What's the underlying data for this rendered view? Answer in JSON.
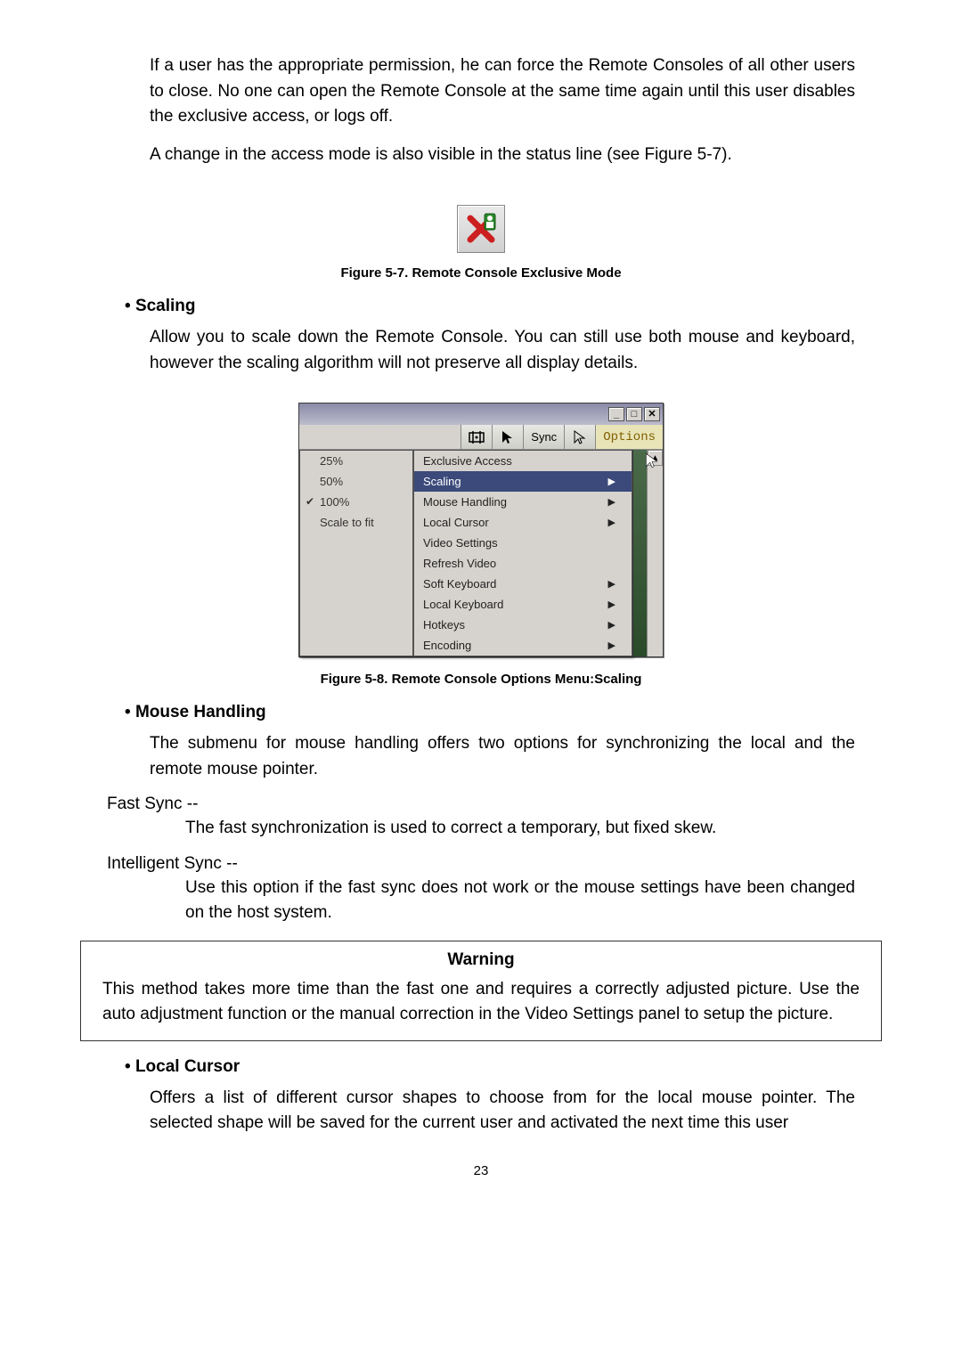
{
  "paragraphs": {
    "p1": "If a user has the appropriate permission, he can force the Remote Consoles of all other users to close. No one can open the Remote Console at the same time again until this user disables the exclusive access, or logs off.",
    "p2": "A change in the access mode is also visible in the status line (see Figure 5-7).",
    "scaling": "Allow you to scale down the Remote Console. You can still use both mouse and keyboard, however the scaling algorithm will not preserve all display details.",
    "mouse_handling": "The submenu for mouse handling offers two options for synchronizing the local and the remote mouse pointer.",
    "fast_sync_label": "Fast Sync --",
    "fast_sync_body": "The fast synchronization is used to correct a temporary, but fixed skew.",
    "int_sync_label": "Intelligent Sync --",
    "int_sync_body": "Use this option if the fast sync does not work or the mouse settings have been changed on the host system.",
    "local_cursor": "Offers a list of different cursor shapes to choose from for the local mouse pointer. The selected shape will be saved for the current user and activated the next time this user"
  },
  "headings": {
    "scaling": "Scaling",
    "mouse_handling": "Mouse Handling",
    "local_cursor": "Local Cursor"
  },
  "captions": {
    "fig57": "Figure 5-7. Remote Console Exclusive Mode",
    "fig58": "Figure 5-8. Remote Console Options Menu:Scaling"
  },
  "warning": {
    "title": "Warning",
    "body": "This method takes more time than the fast one and requires a correctly adjusted picture. Use the auto adjustment function or the manual correction in the Video Settings panel to setup the picture."
  },
  "fig58_window": {
    "toolbar_sync": "Sync",
    "options_label": "Options",
    "submenu": [
      "25%",
      "50%",
      "100%",
      "Scale to fit"
    ],
    "submenu_checked_index": 2,
    "mainmenu": [
      {
        "label": "Exclusive Access",
        "arrow": false
      },
      {
        "label": "Scaling",
        "arrow": true,
        "highlight": true
      },
      {
        "label": "Mouse Handling",
        "arrow": true
      },
      {
        "label": "Local Cursor",
        "arrow": true
      },
      {
        "label": "Video Settings",
        "arrow": false
      },
      {
        "label": "Refresh Video",
        "arrow": false
      },
      {
        "label": "Soft Keyboard",
        "arrow": true
      },
      {
        "label": "Local Keyboard",
        "arrow": true
      },
      {
        "label": "Hotkeys",
        "arrow": true
      },
      {
        "label": "Encoding",
        "arrow": true
      }
    ]
  },
  "page_number": "23"
}
